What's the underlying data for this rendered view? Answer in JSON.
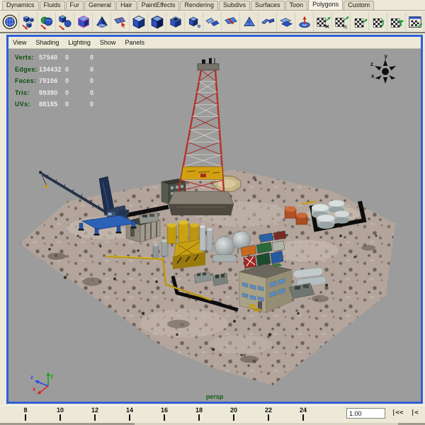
{
  "shelf": {
    "tabs": [
      "Dynamics",
      "Fluids",
      "Fur",
      "General",
      "Hair",
      "PaintEffects",
      "Rendering",
      "Subdivs",
      "Surfaces",
      "Toon",
      "Polygons",
      "Custom"
    ],
    "active_tab": "Polygons",
    "icons": [
      {
        "name": "polygon-sphere-tool-icon",
        "sym": "circled-sphere"
      },
      {
        "name": "polygon-combine-icon",
        "sym": "cubes-arrow"
      },
      {
        "name": "polygon-boolean-union-icon",
        "sym": "bool-spheres"
      },
      {
        "name": "polygon-boolean-difference-icon",
        "sym": "cube-sphere"
      },
      {
        "name": "polygon-smooth-icon",
        "sym": "wire-cube"
      },
      {
        "name": "polygon-extrude-face-icon",
        "sym": "pyramid"
      },
      {
        "name": "polygon-split-tool-icon",
        "sym": "plane-cursor"
      },
      {
        "name": "polygon-cube-top-face-icon",
        "sym": "cube-face"
      },
      {
        "name": "polygon-extract-face-icon",
        "sym": "cube-dark"
      },
      {
        "name": "polygon-open-cube-icon",
        "sym": "open-cube"
      },
      {
        "name": "polygon-duplicate-face-icon",
        "sym": "small-cube"
      },
      {
        "name": "polygon-mirror-planes-icon",
        "sym": "planes-pair"
      },
      {
        "name": "polygon-cut-plane-icon",
        "sym": "plane-red"
      },
      {
        "name": "polygon-triangulate-icon",
        "sym": "triangle-plane"
      },
      {
        "name": "polygon-fold-plane-icon",
        "sym": "bent-plane"
      },
      {
        "name": "polygon-quadrangulate-icon",
        "sym": "planes-two"
      },
      {
        "name": "polygon-center-pivot-icon",
        "sym": "axis-pivot"
      },
      {
        "name": "uv-cut-edges-icon",
        "sym": "checker-x"
      },
      {
        "name": "uv-auto-projection-icon",
        "sym": "checker-aj"
      },
      {
        "name": "uv-planar-projection-icon",
        "sym": "checker-arrow"
      },
      {
        "name": "uv-cylindrical-projection-icon",
        "sym": "checker-circ"
      },
      {
        "name": "uv-transfer-icon",
        "sym": "checker-t"
      },
      {
        "name": "uv-texture-editor-icon",
        "sym": "window-checker"
      }
    ]
  },
  "viewport": {
    "menu": [
      "View",
      "Shading",
      "Lighting",
      "Show",
      "Panels"
    ],
    "hud": {
      "rows": [
        {
          "label": "Verts:",
          "v1": "57540",
          "v2": "0",
          "v3": "0"
        },
        {
          "label": "Edges:",
          "v1": "134432",
          "v2": "0",
          "v3": "0"
        },
        {
          "label": "Faces:",
          "v1": "79106",
          "v2": "0",
          "v3": "0"
        },
        {
          "label": "Tris:",
          "v1": "99390",
          "v2": "0",
          "v3": "0"
        },
        {
          "label": "UVs:",
          "v1": "88185",
          "v2": "0",
          "v3": "0"
        }
      ]
    },
    "camera_label": "persp",
    "compass_labels": {
      "y": "y",
      "z": "z",
      "x": "x"
    },
    "gizmo_labels": {
      "x": "x",
      "y": "y",
      "z": "z"
    }
  },
  "timeline": {
    "ticks": [
      "8",
      "10",
      "12",
      "14",
      "16",
      "18",
      "20",
      "22",
      "24"
    ],
    "current_time": "1.00",
    "rewind_label": "|<<",
    "step_back_label": "|<"
  },
  "colors": {
    "panel_bg": "#ece9d8",
    "viewport_bg": "#9c9c9c",
    "active_panel_border": "#2f5fd8",
    "hud_label_green": "#0a4f0a",
    "hud_value_white": "#ededed",
    "camera_label_green": "#156015",
    "derrick_red": "#a82820",
    "derrick_white": "#d8d4cc",
    "derrick_band_yellow": "#d2a012",
    "ground_dirt": "#b3a59c",
    "crane_blue": "#2b62b8"
  }
}
